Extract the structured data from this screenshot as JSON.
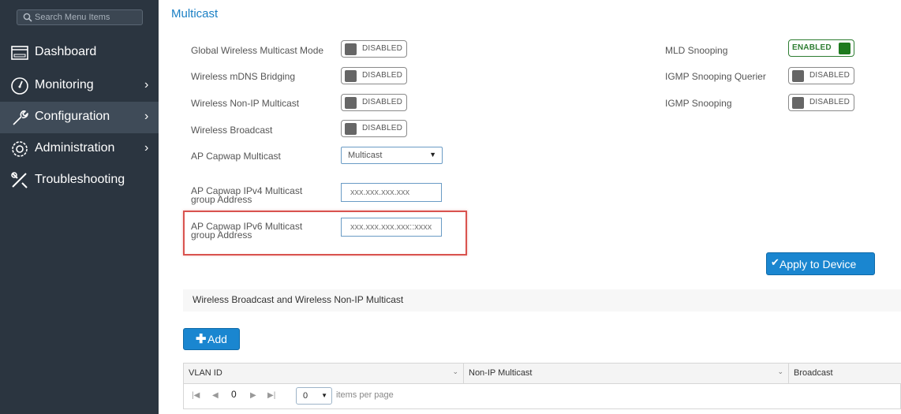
{
  "sidebar": {
    "search_placeholder": "Search Menu Items",
    "items": [
      {
        "label": "Dashboard",
        "icon": "dashboard-icon"
      },
      {
        "label": "Monitoring",
        "icon": "gauge-icon"
      },
      {
        "label": "Configuration",
        "icon": "wrench-icon"
      },
      {
        "label": "Administration",
        "icon": "gear-icon"
      },
      {
        "label": "Troubleshooting",
        "icon": "tools-icon"
      }
    ],
    "chevron": "›"
  },
  "page": {
    "title": "Multicast"
  },
  "settings_left": [
    {
      "label": "Global Wireless Multicast Mode",
      "state": "DISABLED"
    },
    {
      "label": "Wireless mDNS Bridging",
      "state": "DISABLED"
    },
    {
      "label": "Wireless Non-IP Multicast",
      "state": "DISABLED"
    },
    {
      "label": "Wireless Broadcast",
      "state": "DISABLED"
    },
    {
      "label": "AP Capwap Multicast",
      "value": "Multicast"
    },
    {
      "label_line1": "AP Capwap IPv4 Multicast",
      "label_line2": "group Address",
      "placeholder": "xxx.xxx.xxx.xxx"
    },
    {
      "label_line1": "AP Capwap IPv6 Multicast",
      "label_line2": "group Address",
      "placeholder": "xxx.xxx.xxx.xxx::xxxx"
    }
  ],
  "settings_right": [
    {
      "label": "MLD Snooping",
      "state": "ENABLED"
    },
    {
      "label": "IGMP Snooping Querier",
      "state": "DISABLED"
    },
    {
      "label": "IGMP Snooping",
      "state": "DISABLED"
    }
  ],
  "buttons": {
    "apply": "Apply to Device",
    "add": "Add",
    "check_glyph": "✔",
    "plus_glyph": "✚"
  },
  "section": {
    "title": "Wireless Broadcast and Wireless Non-IP Multicast"
  },
  "table": {
    "columns": [
      "VLAN ID",
      "Non-IP Multicast",
      "Broadcast"
    ],
    "sort_glyph": "⌄",
    "pager": {
      "page": "0",
      "page_size": "0",
      "items_per_page": "items per page"
    }
  },
  "colors": {
    "accent": "#1a86d0",
    "enabled": "#2e7d32",
    "sidebar": "#2b3540",
    "highlight": "#d9534f"
  }
}
